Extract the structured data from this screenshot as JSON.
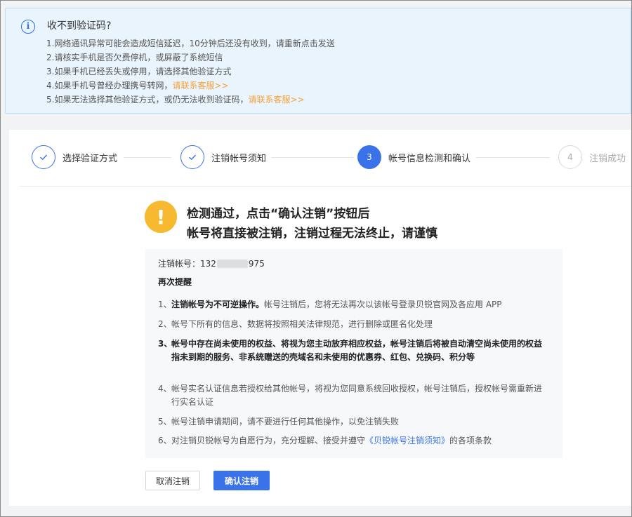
{
  "notice": {
    "title": "收不到验证码?",
    "lines": [
      "1.网络通讯异常可能会造成短信延迟，10分钟后还没有收到，请重新点击发送",
      "2.请核实手机是否欠费停机，或屏蔽了系统短信",
      "3.如果手机已经丢失或停用，请选择其他验证方式",
      "4.如果手机号曾经办理携号转网，",
      "5.如果无法选择其他验证方式，或仍无法收到验证码，"
    ],
    "link_label": "请联系客服>>"
  },
  "steps": [
    {
      "label": "选择验证方式",
      "state": "done"
    },
    {
      "label": "注销帐号须知",
      "state": "done"
    },
    {
      "number": "3",
      "label": "帐号信息检测和确认",
      "state": "active"
    },
    {
      "number": "4",
      "label": "注销成功",
      "state": "todo"
    }
  ],
  "warning": {
    "line1": "检测通过，点击“确认注销”按钮后",
    "line2": "帐号将直接被注销，注销过程无法终止，请谨慎"
  },
  "info": {
    "account_label": "注销帐号：",
    "account_prefix": "132",
    "account_suffix": "975",
    "remind_title": "再次提醒",
    "items": [
      {
        "num": "1、",
        "bold": "注销帐号为不可逆操作。",
        "text": "帐号注销后，您将无法再次以该帐号登录贝锐官网及各应用 APP"
      },
      {
        "num": "2、",
        "text": "帐号下所有的信息、数据将按照相关法律规范，进行删除或匿名化处理"
      },
      {
        "num": "3、",
        "text": "帐号中存在尚未使用的权益、将视为您主动放弃相应权益，帐号注销后将被自动清空尚未使用的权益指未到期的服务、非系统赠送的壳域名和未使用的优惠券、红包、兑换码、积分等"
      },
      {
        "num": "4、",
        "text": "帐号实名认证信息若授权给其他帐号，将视为您同意系统回收授权，帐号注销后，授权帐号需重新进行实名认证"
      },
      {
        "num": "5、",
        "text": "帐号注销申请期间，请不要进行任何其他操作，以免注销失败"
      },
      {
        "num": "6、",
        "text": "对注销贝锐帐号为自愿行为，充分理解、接受并遵守",
        "link": "《贝锐帐号注销须知》",
        "after": "的各项条款"
      }
    ]
  },
  "buttons": {
    "cancel": "取消注销",
    "confirm": "确认注销"
  },
  "colors": {
    "primary": "#3a72ea",
    "warning": "#f7b92f",
    "link_orange": "#f6a13a",
    "notice_bg": "#e9f4fc"
  }
}
